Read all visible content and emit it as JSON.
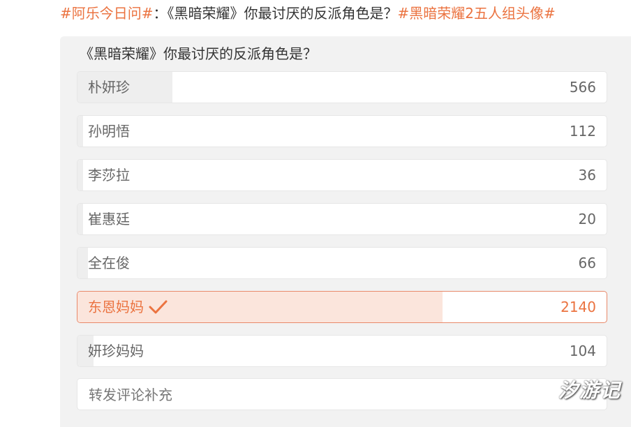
{
  "post": {
    "hashtag1": "#阿乐今日问#",
    "separator": "：",
    "question_text": "《黑暗荣耀》你最讨厌的反派角色是？",
    "hashtag2": "#黑暗荣耀2五人组头像#"
  },
  "poll": {
    "question": "《黑暗荣耀》你最讨厌的反派角色是？",
    "options": [
      {
        "label": "朴妍珍",
        "count": "566",
        "share": 0.18,
        "selected": false
      },
      {
        "label": "孙明悟",
        "count": "112",
        "share": 0.01,
        "selected": false
      },
      {
        "label": "李莎拉",
        "count": "36",
        "share": 0.01,
        "selected": false
      },
      {
        "label": "崔惠廷",
        "count": "20",
        "share": 0.01,
        "selected": false
      },
      {
        "label": "全在俊",
        "count": "66",
        "share": 0.02,
        "selected": false
      },
      {
        "label": "东恩妈妈",
        "count": "2140",
        "share": 0.69,
        "selected": true
      },
      {
        "label": "妍珍妈妈",
        "count": "104",
        "share": 0.03,
        "selected": false
      }
    ],
    "comment_placeholder": "转发评论补充"
  },
  "colors": {
    "accent": "#eb7340",
    "bar_fill": "#eeeeee",
    "selected_fill": "#fbe5dc"
  },
  "watermark": "汐游记"
}
